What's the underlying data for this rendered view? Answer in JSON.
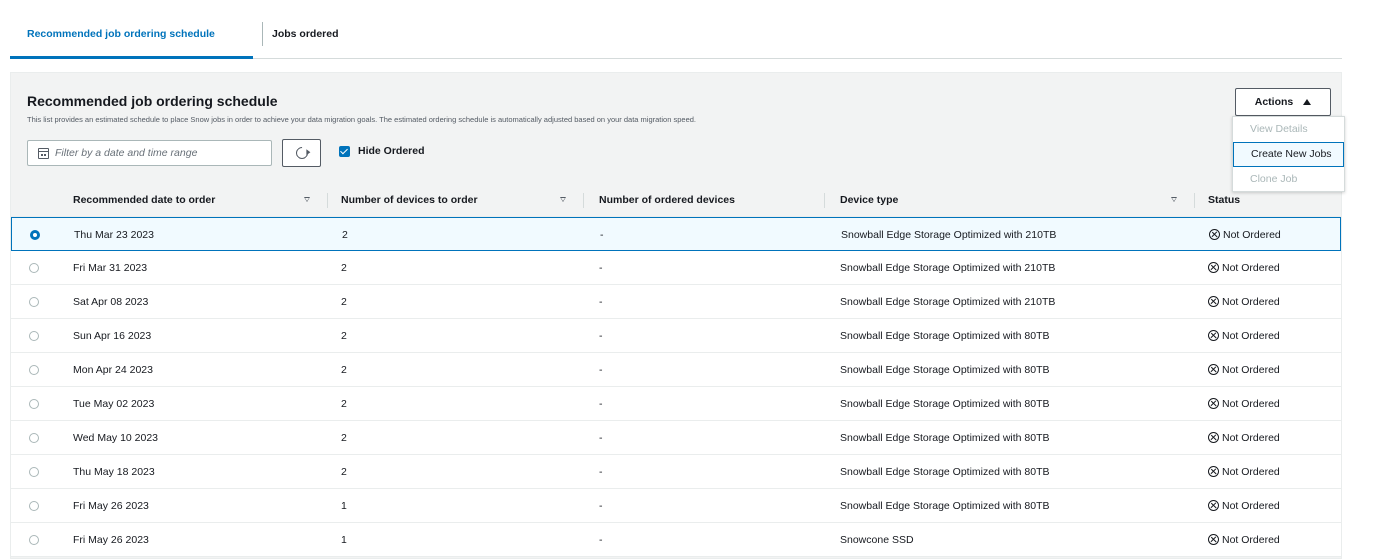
{
  "tabs": {
    "active": "Recommended job ordering schedule",
    "inactive": "Jobs ordered"
  },
  "panel": {
    "title": "Recommended job ordering schedule",
    "description": "This list provides an estimated schedule to place Snow jobs in order to achieve your data migration goals. The estimated ordering schedule is automatically adjusted based on your data migration speed."
  },
  "filter": {
    "placeholder": "Filter by a date and time range",
    "icon": "calendar-icon"
  },
  "refresh": {
    "icon": "refresh-icon"
  },
  "hide_ordered": {
    "label": "Hide Ordered",
    "checked": true
  },
  "actions": {
    "label": "Actions",
    "expanded": true,
    "menu": [
      "View Details",
      "Create New Jobs",
      "Clone Job"
    ],
    "highlighted": "Create New Jobs"
  },
  "table": {
    "columns": [
      "Recommended date to order",
      "Number of devices to order",
      "Number of ordered devices",
      "Device type",
      "Status"
    ],
    "rows": [
      {
        "date": "Thu Mar 23 2023",
        "num": "2",
        "ordered": "-",
        "device": "Snowball Edge Storage Optimized with 210TB",
        "status": "Not Ordered",
        "selected": true
      },
      {
        "date": "Fri Mar 31 2023",
        "num": "2",
        "ordered": "-",
        "device": "Snowball Edge Storage Optimized with 210TB",
        "status": "Not Ordered"
      },
      {
        "date": "Sat Apr 08 2023",
        "num": "2",
        "ordered": "-",
        "device": "Snowball Edge Storage Optimized with 210TB",
        "status": "Not Ordered"
      },
      {
        "date": "Sun Apr 16 2023",
        "num": "2",
        "ordered": "-",
        "device": "Snowball Edge Storage Optimized with 80TB",
        "status": "Not Ordered"
      },
      {
        "date": "Mon Apr 24 2023",
        "num": "2",
        "ordered": "-",
        "device": "Snowball Edge Storage Optimized with 80TB",
        "status": "Not Ordered"
      },
      {
        "date": "Tue May 02 2023",
        "num": "2",
        "ordered": "-",
        "device": "Snowball Edge Storage Optimized with 80TB",
        "status": "Not Ordered"
      },
      {
        "date": "Wed May 10 2023",
        "num": "2",
        "ordered": "-",
        "device": "Snowball Edge Storage Optimized with 80TB",
        "status": "Not Ordered"
      },
      {
        "date": "Thu May 18 2023",
        "num": "2",
        "ordered": "-",
        "device": "Snowball Edge Storage Optimized with 80TB",
        "status": "Not Ordered"
      },
      {
        "date": "Fri May 26 2023",
        "num": "1",
        "ordered": "-",
        "device": "Snowball Edge Storage Optimized with 80TB",
        "status": "Not Ordered"
      },
      {
        "date": "Fri May 26 2023",
        "num": "1",
        "ordered": "-",
        "device": "Snowcone SSD",
        "status": "Not Ordered"
      }
    ]
  },
  "colors": {
    "accent": "#0073bb",
    "panel_bg": "#f2f3f3",
    "selected_row_bg": "#f1faff",
    "text": "#16191f",
    "disabled_text": "#aab7b8"
  }
}
